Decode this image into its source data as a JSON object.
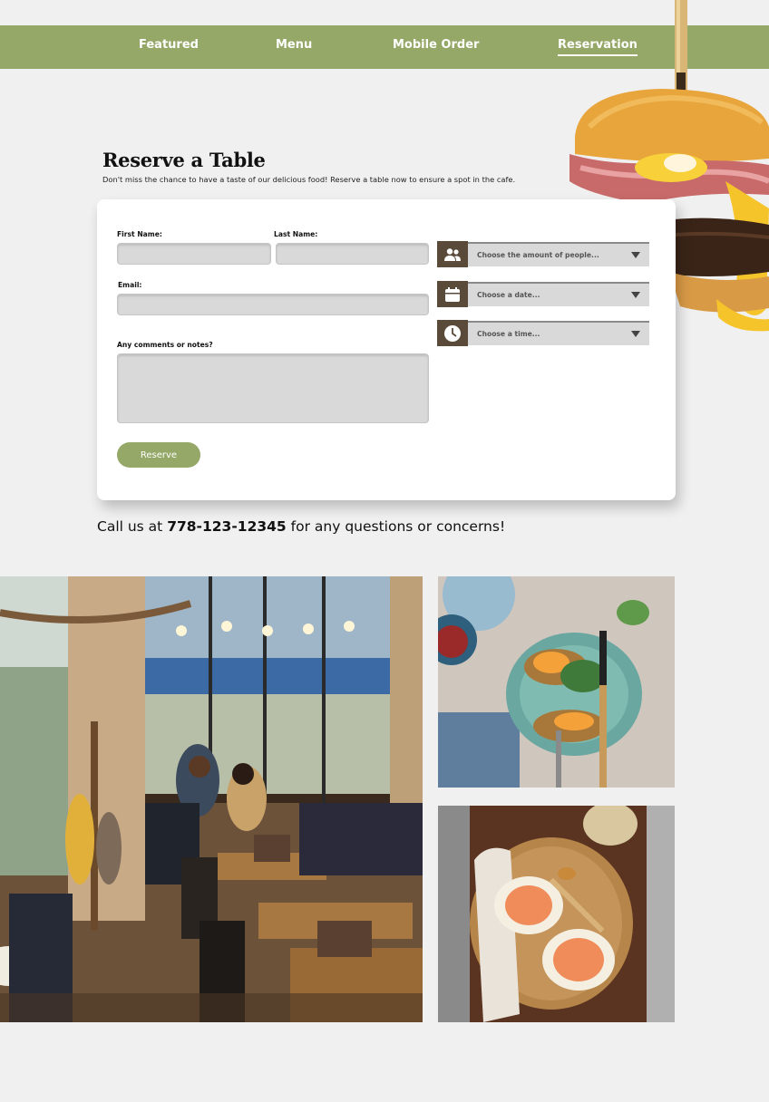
{
  "nav": {
    "items": [
      {
        "label": "Featured"
      },
      {
        "label": "Menu"
      },
      {
        "label": "Mobile Order"
      },
      {
        "label": "Reservation"
      }
    ],
    "active": "Reservation"
  },
  "hero": {
    "title": "Reserve a Table",
    "subtitle": "Don't miss the chance to have a taste of our delicious food! Reserve a table now to ensure a spot in the cafe."
  },
  "form": {
    "first_name_label": "First Name:",
    "last_name_label": "Last Name:",
    "email_label": "Email:",
    "comments_label": "Any comments or notes?",
    "first_name_value": "",
    "last_name_value": "",
    "email_value": "",
    "comments_value": "",
    "people_select": {
      "placeholder": "Choose the amount of people...",
      "icon": "people-icon"
    },
    "date_select": {
      "placeholder": "Choose a date...",
      "icon": "calendar-icon"
    },
    "time_select": {
      "placeholder": "Choose a time...",
      "icon": "clock-icon"
    },
    "submit_label": "Reserve"
  },
  "contact": {
    "prefix": "Call us at",
    "phone": "778-123-12345",
    "suffix": "for any questions or concerns!"
  },
  "colors": {
    "accent_green": "#95a868",
    "icon_brown": "#5a4a3a",
    "input_gray": "#d9d9d9",
    "background": "#f0f0f0"
  }
}
